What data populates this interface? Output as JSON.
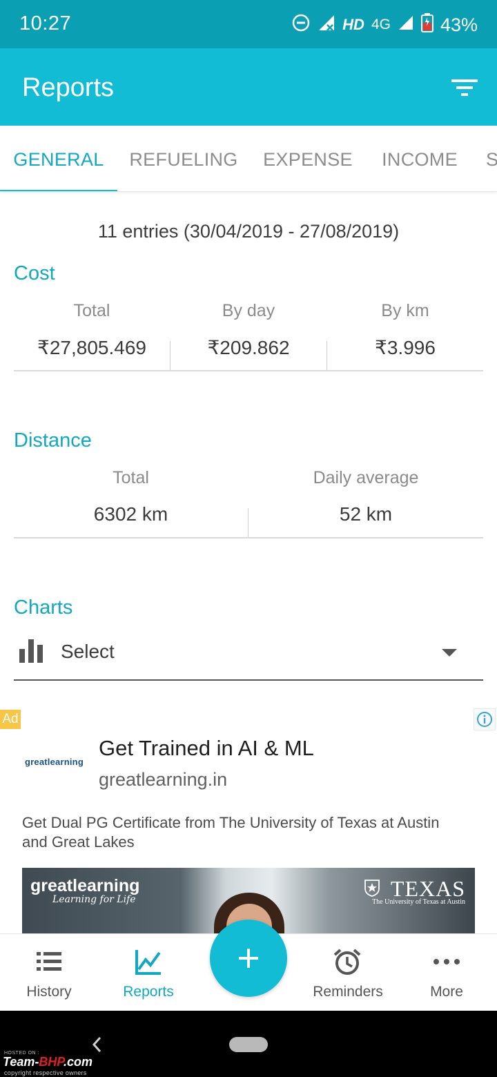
{
  "status_bar": {
    "time": "10:27",
    "network_type": "HD",
    "signal_label": "4G",
    "battery_percent": "43%"
  },
  "app_bar": {
    "title": "Reports",
    "filter_icon": "filter-icon"
  },
  "tabs": [
    {
      "label": "GENERAL",
      "active": true
    },
    {
      "label": "REFUELING",
      "active": false
    },
    {
      "label": "EXPENSE",
      "active": false
    },
    {
      "label": "INCOME",
      "active": false
    },
    {
      "label": "S",
      "active": false
    }
  ],
  "summary": {
    "entries_text": "11 entries (30/04/2019 - 27/08/2019)"
  },
  "cost": {
    "title": "Cost",
    "columns": [
      {
        "label": "Total",
        "value": "₹27,805.469"
      },
      {
        "label": "By day",
        "value": "₹209.862"
      },
      {
        "label": "By km",
        "value": "₹3.996"
      }
    ]
  },
  "distance": {
    "title": "Distance",
    "columns": [
      {
        "label": "Total",
        "value": "6302 km"
      },
      {
        "label": "Daily average",
        "value": "52 km"
      }
    ]
  },
  "charts": {
    "title": "Charts",
    "select_value": "Select",
    "icon": "bar-chart-icon"
  },
  "ad": {
    "badge": "Ad",
    "logo_text": "greatlearning",
    "headline": "Get Trained in AI & ML",
    "domain": "greatlearning.in",
    "description": "Get Dual PG Certificate from The University of Texas at Austin and Great Lakes",
    "image_brand": "greatlearning",
    "image_tagline": "Learning for Life",
    "image_texas": "TEXAS",
    "image_ut": "The University of Texas at Austin"
  },
  "bottom_nav": {
    "items": [
      {
        "label": "History",
        "icon": "list-icon",
        "active": false
      },
      {
        "label": "Reports",
        "icon": "chart-line-icon",
        "active": true
      },
      {
        "label": "Reminders",
        "icon": "alarm-clock-icon",
        "active": false
      },
      {
        "label": "More",
        "icon": "more-dots-icon",
        "active": false
      }
    ],
    "fab_icon": "plus-icon"
  },
  "watermark": {
    "small": "HOSTED ON :",
    "brand_prefix": "Team-",
    "brand_red": "BHP",
    "brand_suffix": ".com",
    "copyright": "copyright respective owners"
  },
  "colors": {
    "status_bar": "#0b9fb4",
    "primary": "#12bcd4",
    "accent_text": "#12a8c1",
    "ad_badge": "#f7c646"
  }
}
